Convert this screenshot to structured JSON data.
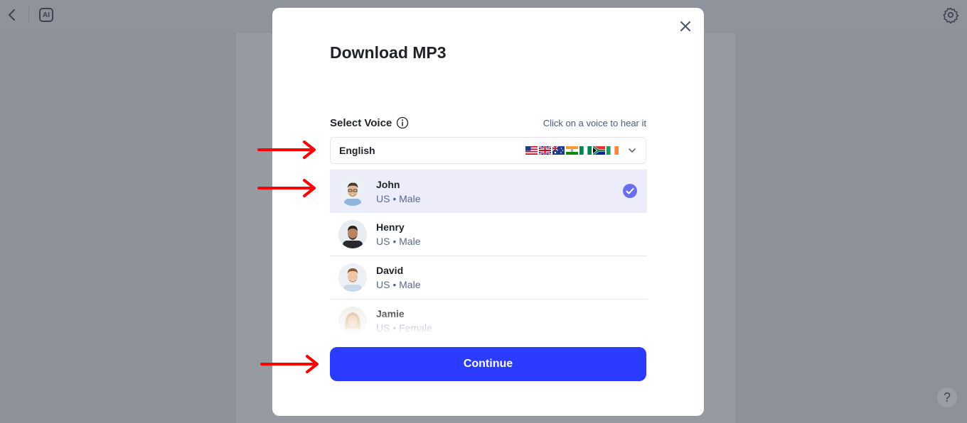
{
  "modal": {
    "title": "Download MP3",
    "select_label": "Select Voice",
    "hint": "Click on a voice to hear it",
    "language": {
      "selected": "English",
      "flags": [
        "us-flag-icon",
        "uk-flag-icon",
        "au-flag-icon",
        "in-flag-icon",
        "ng-flag-icon",
        "za-flag-icon",
        "ie-flag-icon"
      ]
    },
    "voices": [
      {
        "name": "John",
        "meta": "US • Male",
        "selected": true
      },
      {
        "name": "Henry",
        "meta": "US • Male",
        "selected": false
      },
      {
        "name": "David",
        "meta": "US • Male",
        "selected": false
      },
      {
        "name": "Jamie",
        "meta": "US • Female",
        "selected": false
      }
    ],
    "continue_label": "Continue"
  },
  "help_label": "?",
  "ai_label": "AI",
  "colors": {
    "accent": "#2b3bff",
    "selected_row": "#ececfb",
    "check": "#6a6ff0",
    "annotation_arrow": "#ff0000"
  }
}
